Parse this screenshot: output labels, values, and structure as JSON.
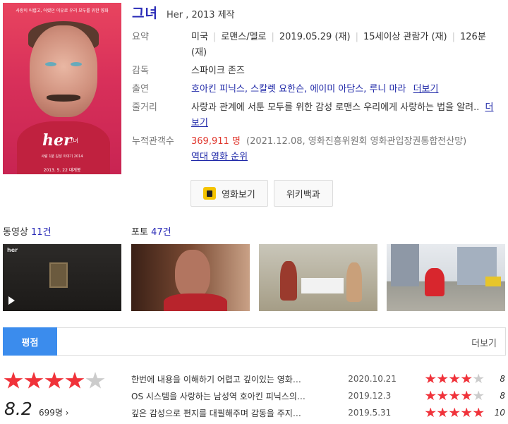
{
  "poster": {
    "tagline": "사랑이 어렵고, 어렸던 이유로 우리 모두를 위한 영화",
    "logo": "her",
    "logo_sub": "그녀",
    "small_text": "사랑 1분 감성 이야기 2014",
    "date": "2013. 5. 22 대개봉"
  },
  "title": "그녀",
  "subtitle": "Her , 2013 제작",
  "info": {
    "summary_label": "요약",
    "summary": [
      "미국",
      "로맨스/멜로",
      "2019.05.29 (재)",
      "15세이상 관람가 (재)",
      "126분 (재)"
    ],
    "director_label": "감독",
    "director": "스파이크 존즈",
    "cast_label": "출연",
    "cast": "호아킨 피닉스, 스칼렛 요한슨, 에이미 아담스, 루니 마라",
    "cast_more": "더보기",
    "plot_label": "줄거리",
    "plot": "사랑과 관계에 서툰 모두를 위한 감성 로맨스 우리에게 사랑하는 법을 알려..",
    "plot_more": "더보기",
    "audience_label": "누적관객수",
    "audience": "369,911 명",
    "audience_note": "(2021.12.08, 영화진흥위원회 영화관입장권통합전산망)",
    "ranking_link": "역대 영화 순위"
  },
  "buttons": {
    "watch": "영화보기",
    "wiki": "위키백과"
  },
  "sections": {
    "video_label": "동영상",
    "video_count": "11건",
    "photo_label": "포토",
    "photo_count": "47건",
    "thumb_logo": "her"
  },
  "rating": {
    "tab": "평점",
    "more": "더보기",
    "score": "8.2",
    "votes": "699명",
    "votes_arrow": "›",
    "stars_filled": 4,
    "reviews": [
      {
        "text": "한번에 내용을 이해하기 어렵고 깊이있는 영화…",
        "date": "2020.10.21",
        "stars": 4,
        "score": "8"
      },
      {
        "text": "OS 시스템을 사랑하는 남성역 호아킨 피닉스의…",
        "date": "2019.12.3",
        "stars": 4,
        "score": "8"
      },
      {
        "text": "깊은 감성으로 편지를 대필해주며 감동을 주지…",
        "date": "2019.5.31",
        "stars": 5,
        "score": "10"
      }
    ]
  },
  "colors": {
    "accent_blue": "#3b8ced",
    "title_blue": "#2a2bb7",
    "star_red": "#f0323a",
    "audience_red": "#e0372d"
  }
}
